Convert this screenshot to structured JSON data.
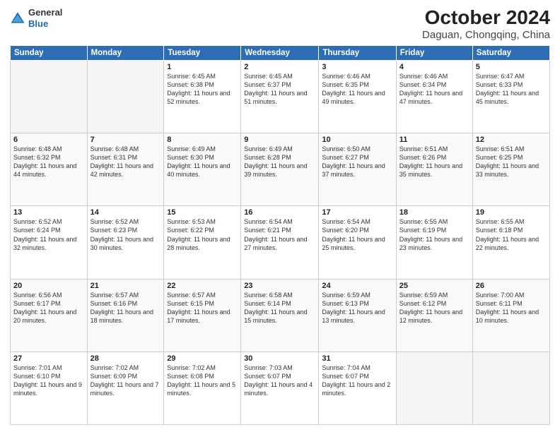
{
  "logo": {
    "general": "General",
    "blue": "Blue"
  },
  "title": "October 2024",
  "subtitle": "Daguan, Chongqing, China",
  "headers": [
    "Sunday",
    "Monday",
    "Tuesday",
    "Wednesday",
    "Thursday",
    "Friday",
    "Saturday"
  ],
  "weeks": [
    [
      {
        "day": "",
        "sunrise": "",
        "sunset": "",
        "daylight": ""
      },
      {
        "day": "",
        "sunrise": "",
        "sunset": "",
        "daylight": ""
      },
      {
        "day": "1",
        "sunrise": "Sunrise: 6:45 AM",
        "sunset": "Sunset: 6:38 PM",
        "daylight": "Daylight: 11 hours and 52 minutes."
      },
      {
        "day": "2",
        "sunrise": "Sunrise: 6:45 AM",
        "sunset": "Sunset: 6:37 PM",
        "daylight": "Daylight: 11 hours and 51 minutes."
      },
      {
        "day": "3",
        "sunrise": "Sunrise: 6:46 AM",
        "sunset": "Sunset: 6:35 PM",
        "daylight": "Daylight: 11 hours and 49 minutes."
      },
      {
        "day": "4",
        "sunrise": "Sunrise: 6:46 AM",
        "sunset": "Sunset: 6:34 PM",
        "daylight": "Daylight: 11 hours and 47 minutes."
      },
      {
        "day": "5",
        "sunrise": "Sunrise: 6:47 AM",
        "sunset": "Sunset: 6:33 PM",
        "daylight": "Daylight: 11 hours and 45 minutes."
      }
    ],
    [
      {
        "day": "6",
        "sunrise": "Sunrise: 6:48 AM",
        "sunset": "Sunset: 6:32 PM",
        "daylight": "Daylight: 11 hours and 44 minutes."
      },
      {
        "day": "7",
        "sunrise": "Sunrise: 6:48 AM",
        "sunset": "Sunset: 6:31 PM",
        "daylight": "Daylight: 11 hours and 42 minutes."
      },
      {
        "day": "8",
        "sunrise": "Sunrise: 6:49 AM",
        "sunset": "Sunset: 6:30 PM",
        "daylight": "Daylight: 11 hours and 40 minutes."
      },
      {
        "day": "9",
        "sunrise": "Sunrise: 6:49 AM",
        "sunset": "Sunset: 6:28 PM",
        "daylight": "Daylight: 11 hours and 39 minutes."
      },
      {
        "day": "10",
        "sunrise": "Sunrise: 6:50 AM",
        "sunset": "Sunset: 6:27 PM",
        "daylight": "Daylight: 11 hours and 37 minutes."
      },
      {
        "day": "11",
        "sunrise": "Sunrise: 6:51 AM",
        "sunset": "Sunset: 6:26 PM",
        "daylight": "Daylight: 11 hours and 35 minutes."
      },
      {
        "day": "12",
        "sunrise": "Sunrise: 6:51 AM",
        "sunset": "Sunset: 6:25 PM",
        "daylight": "Daylight: 11 hours and 33 minutes."
      }
    ],
    [
      {
        "day": "13",
        "sunrise": "Sunrise: 6:52 AM",
        "sunset": "Sunset: 6:24 PM",
        "daylight": "Daylight: 11 hours and 32 minutes."
      },
      {
        "day": "14",
        "sunrise": "Sunrise: 6:52 AM",
        "sunset": "Sunset: 6:23 PM",
        "daylight": "Daylight: 11 hours and 30 minutes."
      },
      {
        "day": "15",
        "sunrise": "Sunrise: 6:53 AM",
        "sunset": "Sunset: 6:22 PM",
        "daylight": "Daylight: 11 hours and 28 minutes."
      },
      {
        "day": "16",
        "sunrise": "Sunrise: 6:54 AM",
        "sunset": "Sunset: 6:21 PM",
        "daylight": "Daylight: 11 hours and 27 minutes."
      },
      {
        "day": "17",
        "sunrise": "Sunrise: 6:54 AM",
        "sunset": "Sunset: 6:20 PM",
        "daylight": "Daylight: 11 hours and 25 minutes."
      },
      {
        "day": "18",
        "sunrise": "Sunrise: 6:55 AM",
        "sunset": "Sunset: 6:19 PM",
        "daylight": "Daylight: 11 hours and 23 minutes."
      },
      {
        "day": "19",
        "sunrise": "Sunrise: 6:55 AM",
        "sunset": "Sunset: 6:18 PM",
        "daylight": "Daylight: 11 hours and 22 minutes."
      }
    ],
    [
      {
        "day": "20",
        "sunrise": "Sunrise: 6:56 AM",
        "sunset": "Sunset: 6:17 PM",
        "daylight": "Daylight: 11 hours and 20 minutes."
      },
      {
        "day": "21",
        "sunrise": "Sunrise: 6:57 AM",
        "sunset": "Sunset: 6:16 PM",
        "daylight": "Daylight: 11 hours and 18 minutes."
      },
      {
        "day": "22",
        "sunrise": "Sunrise: 6:57 AM",
        "sunset": "Sunset: 6:15 PM",
        "daylight": "Daylight: 11 hours and 17 minutes."
      },
      {
        "day": "23",
        "sunrise": "Sunrise: 6:58 AM",
        "sunset": "Sunset: 6:14 PM",
        "daylight": "Daylight: 11 hours and 15 minutes."
      },
      {
        "day": "24",
        "sunrise": "Sunrise: 6:59 AM",
        "sunset": "Sunset: 6:13 PM",
        "daylight": "Daylight: 11 hours and 13 minutes."
      },
      {
        "day": "25",
        "sunrise": "Sunrise: 6:59 AM",
        "sunset": "Sunset: 6:12 PM",
        "daylight": "Daylight: 11 hours and 12 minutes."
      },
      {
        "day": "26",
        "sunrise": "Sunrise: 7:00 AM",
        "sunset": "Sunset: 6:11 PM",
        "daylight": "Daylight: 11 hours and 10 minutes."
      }
    ],
    [
      {
        "day": "27",
        "sunrise": "Sunrise: 7:01 AM",
        "sunset": "Sunset: 6:10 PM",
        "daylight": "Daylight: 11 hours and 9 minutes."
      },
      {
        "day": "28",
        "sunrise": "Sunrise: 7:02 AM",
        "sunset": "Sunset: 6:09 PM",
        "daylight": "Daylight: 11 hours and 7 minutes."
      },
      {
        "day": "29",
        "sunrise": "Sunrise: 7:02 AM",
        "sunset": "Sunset: 6:08 PM",
        "daylight": "Daylight: 11 hours and 5 minutes."
      },
      {
        "day": "30",
        "sunrise": "Sunrise: 7:03 AM",
        "sunset": "Sunset: 6:07 PM",
        "daylight": "Daylight: 11 hours and 4 minutes."
      },
      {
        "day": "31",
        "sunrise": "Sunrise: 7:04 AM",
        "sunset": "Sunset: 6:07 PM",
        "daylight": "Daylight: 11 hours and 2 minutes."
      },
      {
        "day": "",
        "sunrise": "",
        "sunset": "",
        "daylight": ""
      },
      {
        "day": "",
        "sunrise": "",
        "sunset": "",
        "daylight": ""
      }
    ]
  ]
}
